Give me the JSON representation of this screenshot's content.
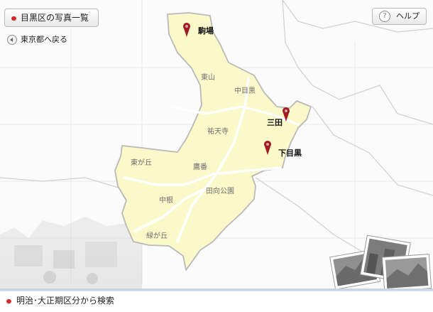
{
  "header": {
    "title": "目黒区の写真一覧",
    "help_label": "ヘルプ",
    "back_link": "東京都へ戻る"
  },
  "map": {
    "colors": {
      "district_fill": "#fbf8c9",
      "district_outline": "#b9b9b9",
      "grid": "#e6e6e6",
      "marker": "#a01c22"
    },
    "areas": [
      "東山",
      "中目黒",
      "祐天寺",
      "東が丘",
      "鷹番",
      "中根",
      "田向公園",
      "緑が丘"
    ],
    "markers": [
      "駒場",
      "三田",
      "下目黒"
    ]
  },
  "footer": {
    "search_label": "明治･大正期区分から検索"
  }
}
